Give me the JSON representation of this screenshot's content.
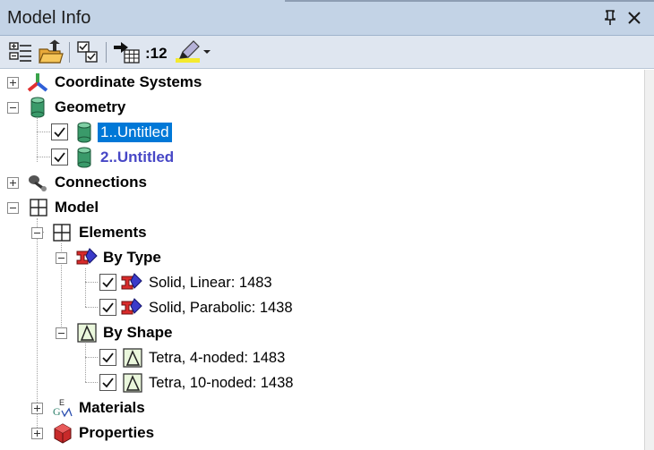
{
  "panel": {
    "title": "Model Info"
  },
  "toolbar": {
    "zoom_label": ":12"
  },
  "tree": {
    "coordinate_systems": "Coordinate Systems",
    "geometry": "Geometry",
    "geometry_item_1": "1..Untitled",
    "geometry_item_2": "2..Untitled",
    "connections": "Connections",
    "model": "Model",
    "elements": "Elements",
    "by_type": "By Type",
    "solid_linear": "Solid, Linear: 1483",
    "solid_parabolic": "Solid, Parabolic: 1438",
    "by_shape": "By Shape",
    "tetra_4": "Tetra, 4-noded: 1483",
    "tetra_10": "Tetra, 10-noded: 1438",
    "materials": "Materials",
    "properties": "Properties"
  },
  "colors": {
    "title_bar": "#c3d3e6",
    "toolbar": "#dfe6f0",
    "selection": "#0078d7",
    "secondary_item_text": "#4747c6",
    "geometry_icon": "#3a9a6a"
  },
  "icons": {
    "coordinate_systems": "axes-icon",
    "geometry": "cylinder-icon",
    "connections": "connector-icon",
    "model": "grid-icon",
    "by_type": "element-type-icon",
    "by_shape": "triangle-icon",
    "materials": "material-icon",
    "properties": "property-block-icon"
  }
}
